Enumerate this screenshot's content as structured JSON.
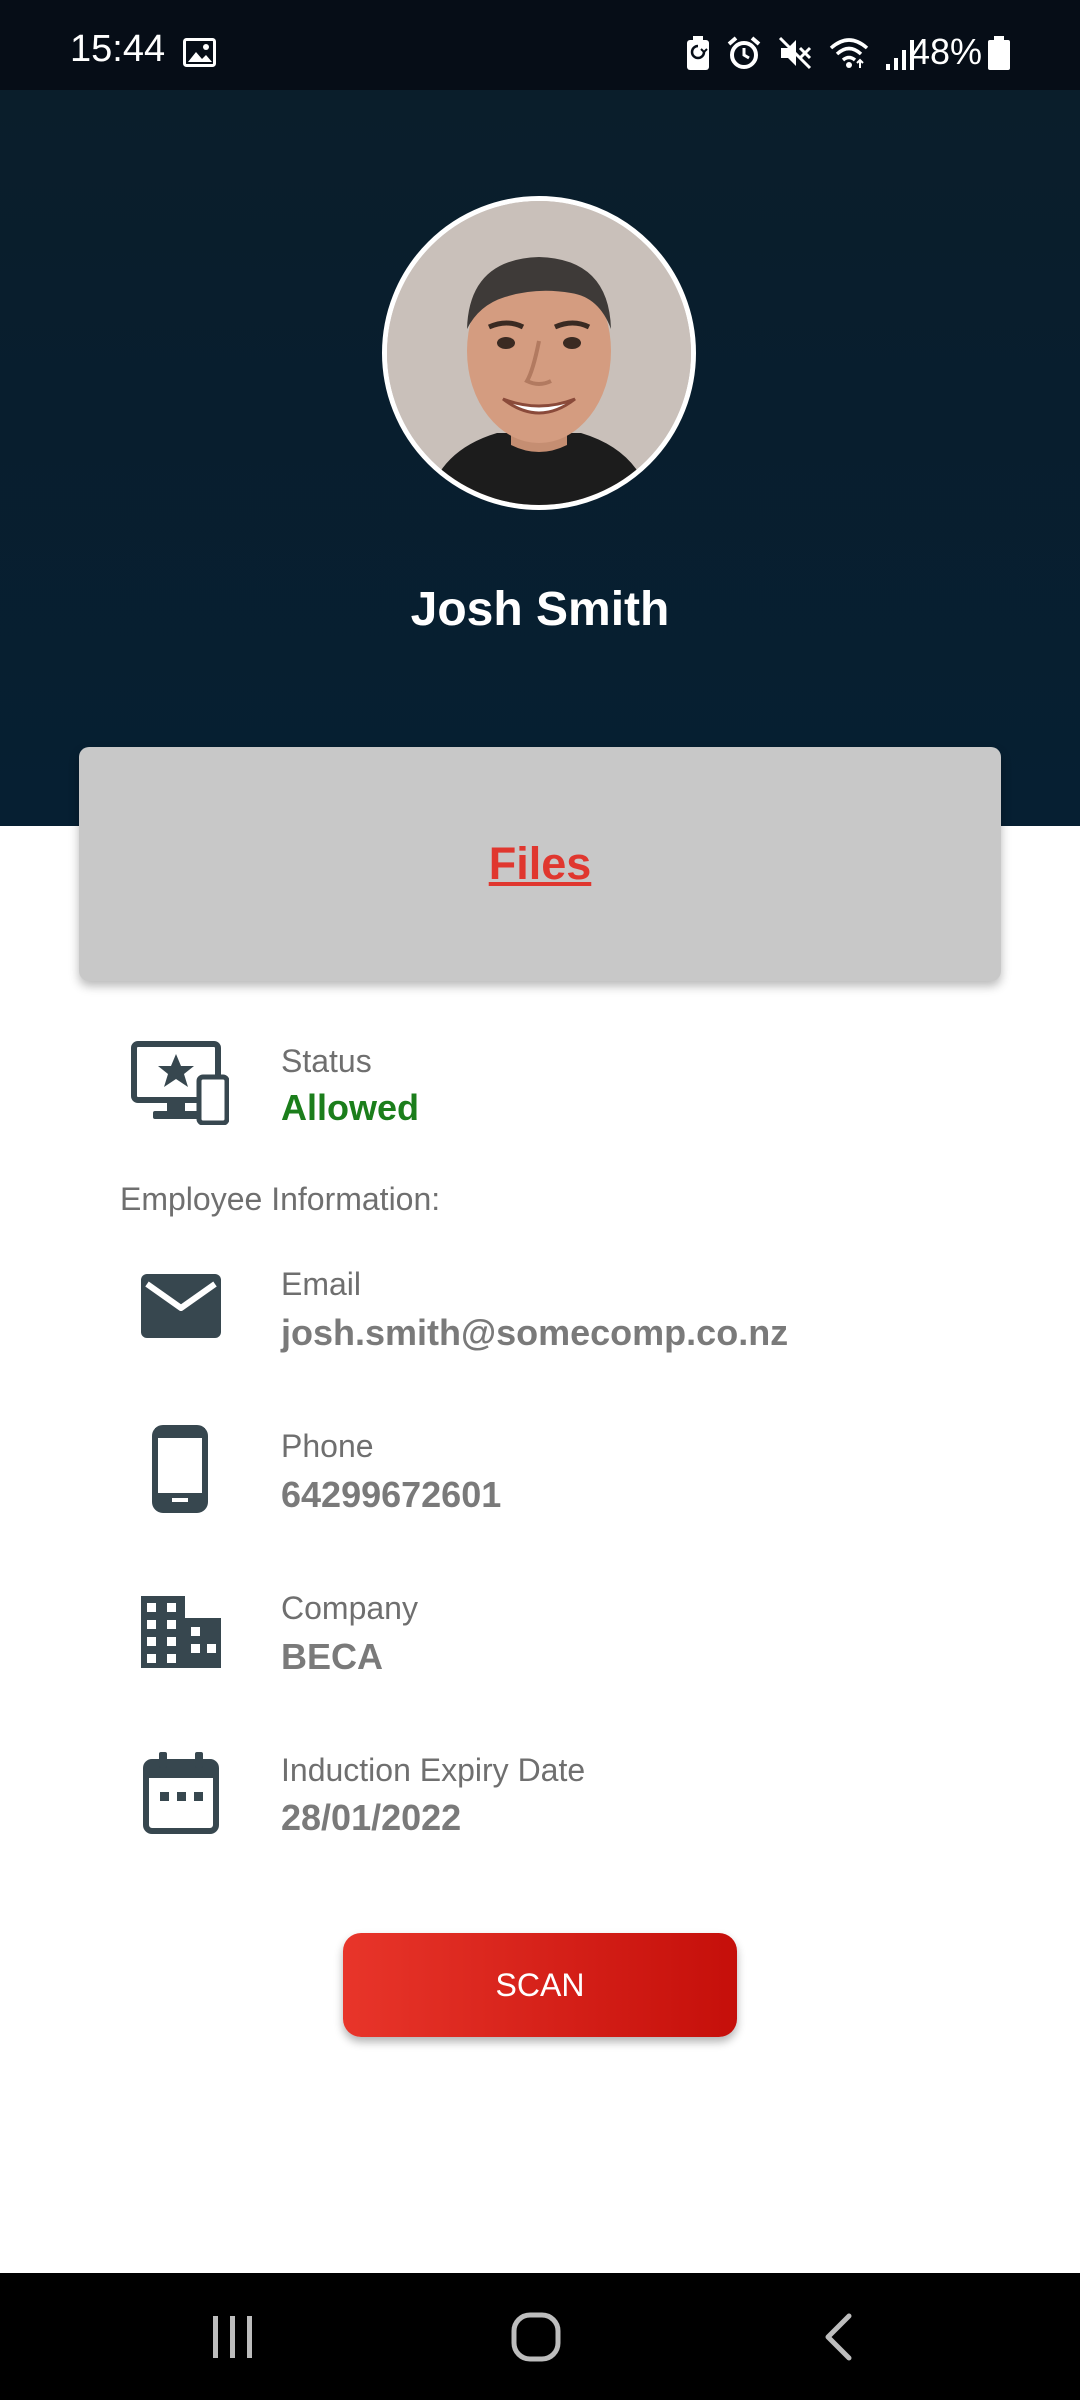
{
  "status_bar": {
    "time": "15:44",
    "battery_percent": "48%",
    "icons": [
      "gallery-icon",
      "battery-saver-icon",
      "alarm-icon",
      "mute-icon",
      "wifi-icon",
      "signal-icon",
      "battery-icon"
    ]
  },
  "profile": {
    "name": "Josh Smith",
    "avatar": "profile-photo"
  },
  "files": {
    "label": "Files"
  },
  "status": {
    "label": "Status",
    "value": "Allowed",
    "value_color": "#1b7e1b",
    "icon": "devices-star-icon"
  },
  "employee_section": {
    "title": "Employee Information:",
    "fields": [
      {
        "label": "Email",
        "value": "josh.smith@somecomp.co.nz",
        "icon": "email-icon"
      },
      {
        "label": "Phone",
        "value": "64299672601",
        "icon": "phone-icon"
      },
      {
        "label": "Company",
        "value": "BECA",
        "icon": "building-icon"
      },
      {
        "label": "Induction Expiry Date",
        "value": "28/01/2022",
        "icon": "calendar-icon"
      }
    ]
  },
  "scan_button": {
    "label": "SCAN",
    "color": "#d9231b"
  },
  "nav_bar": {
    "buttons": [
      "recents-icon",
      "home-icon",
      "back-icon"
    ]
  },
  "colors": {
    "header_background": "#081e2e",
    "accent_red": "#e0372f",
    "icon_color": "#37474f"
  }
}
